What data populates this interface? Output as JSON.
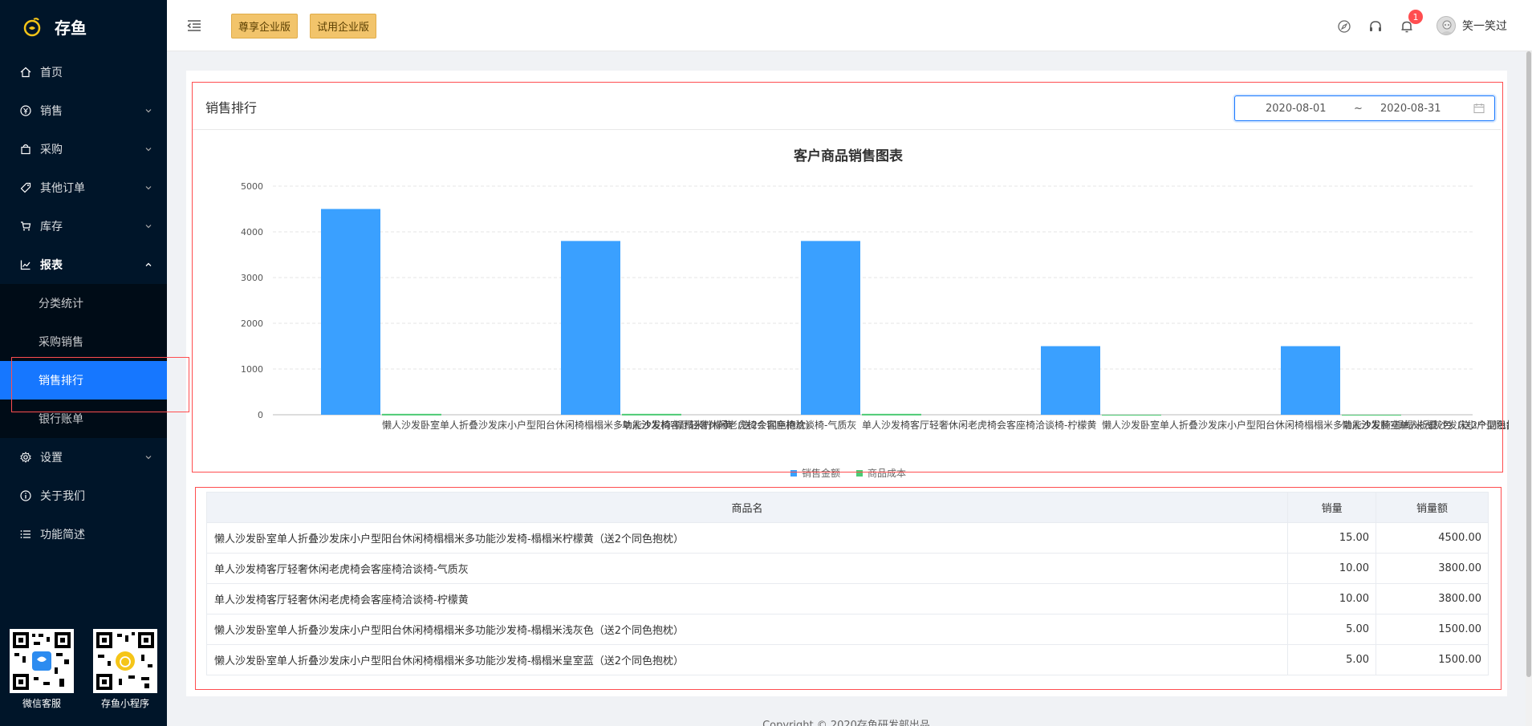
{
  "app": {
    "name": "存鱼"
  },
  "sidebar": {
    "items": [
      {
        "label": "首页",
        "icon": "home-icon"
      },
      {
        "label": "销售",
        "icon": "yen-icon"
      },
      {
        "label": "采购",
        "icon": "bag-icon"
      },
      {
        "label": "其他订单",
        "icon": "tag-icon"
      },
      {
        "label": "库存",
        "icon": "cart-icon"
      },
      {
        "label": "报表",
        "icon": "chart-line-icon"
      },
      {
        "label": "设置",
        "icon": "gear-icon"
      },
      {
        "label": "关于我们",
        "icon": "info-icon"
      },
      {
        "label": "功能简述",
        "icon": "list-icon"
      }
    ],
    "report_sub": [
      "分类统计",
      "采购销售",
      "销售排行",
      "银行账单"
    ],
    "qr": [
      {
        "label": "微信客服"
      },
      {
        "label": "存鱼小程序"
      }
    ]
  },
  "header": {
    "tag1": "尊享企业版",
    "tag2": "试用企业版",
    "badge_count": "1",
    "user_name": "笑一笑过"
  },
  "card": {
    "title": "销售排行",
    "date_start": "2020-08-01",
    "date_sep": "~",
    "date_end": "2020-08-31"
  },
  "chart_data": {
    "type": "bar",
    "title": "客户商品销售图表",
    "categories": [
      "懒人沙发卧室单人折叠沙发床小户型阳台休闲椅榻榻米多功能沙发椅-榻榻米柠檬黄（送2个同色抱枕）",
      "单人沙发椅客厅轻奢休闲老虎椅会客座椅洽谈椅-气质灰",
      "单人沙发椅客厅轻奢休闲老虎椅会客座椅洽谈椅-柠檬黄",
      "懒人沙发卧室单人折叠沙发床小户型阳台休闲椅榻榻米多功能沙发椅-榻榻米浅灰色（送2个同色抱枕）",
      "懒人沙发卧室单人折叠沙发床小户型阳台休闲椅榻榻米多功能沙发椅-榻榻米皇室蓝（送2个同色抱枕）"
    ],
    "series": [
      {
        "name": "销售金额",
        "color": "#3aa0ff",
        "values": [
          4500,
          3800,
          3800,
          1500,
          1500
        ]
      },
      {
        "name": "商品成本",
        "color": "#4cca73",
        "values": [
          20,
          20,
          20,
          0,
          0
        ]
      }
    ],
    "yticks": [
      "0",
      "1000",
      "2000",
      "3000",
      "4000",
      "5000"
    ],
    "ylim": [
      0,
      5000
    ],
    "grid": true,
    "legend": "bottom-center"
  },
  "table": {
    "headers": [
      "商品名",
      "销量",
      "销量额"
    ],
    "rows": [
      [
        "懒人沙发卧室单人折叠沙发床小户型阳台休闲椅榻榻米多功能沙发椅-榻榻米柠檬黄（送2个同色抱枕）",
        "15.00",
        "4500.00"
      ],
      [
        "单人沙发椅客厅轻奢休闲老虎椅会客座椅洽谈椅-气质灰",
        "10.00",
        "3800.00"
      ],
      [
        "单人沙发椅客厅轻奢休闲老虎椅会客座椅洽谈椅-柠檬黄",
        "10.00",
        "3800.00"
      ],
      [
        "懒人沙发卧室单人折叠沙发床小户型阳台休闲椅榻榻米多功能沙发椅-榻榻米浅灰色（送2个同色抱枕）",
        "5.00",
        "1500.00"
      ],
      [
        "懒人沙发卧室单人折叠沙发床小户型阳台休闲椅榻榻米多功能沙发椅-榻榻米皇室蓝（送2个同色抱枕）",
        "5.00",
        "1500.00"
      ]
    ]
  },
  "footer": {
    "text": "Copyright © 2020存鱼研发部出品"
  }
}
